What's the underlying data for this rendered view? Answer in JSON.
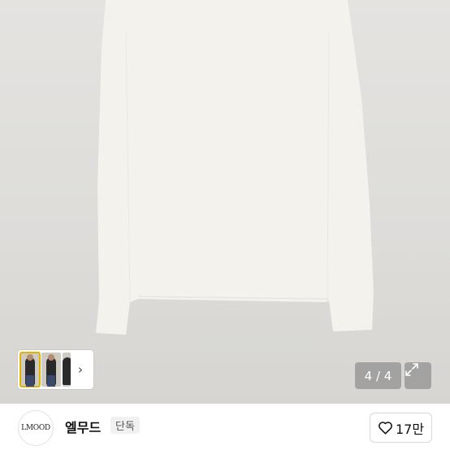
{
  "product": {
    "image_counter": "4 / 4",
    "thumbnail_count": 3,
    "active_thumbnail": 1
  },
  "brand": {
    "logo_text": "LMOOD",
    "name": "엘무드",
    "badge": "단독"
  },
  "likes": {
    "count": "17만"
  },
  "icons": {
    "expand": "expand-icon",
    "next": "chevron-right-icon",
    "like": "heart-outline-icon"
  },
  "colors": {
    "garment": "#f4f2ec",
    "background": "#dfdedb",
    "overlay": "#787878"
  }
}
